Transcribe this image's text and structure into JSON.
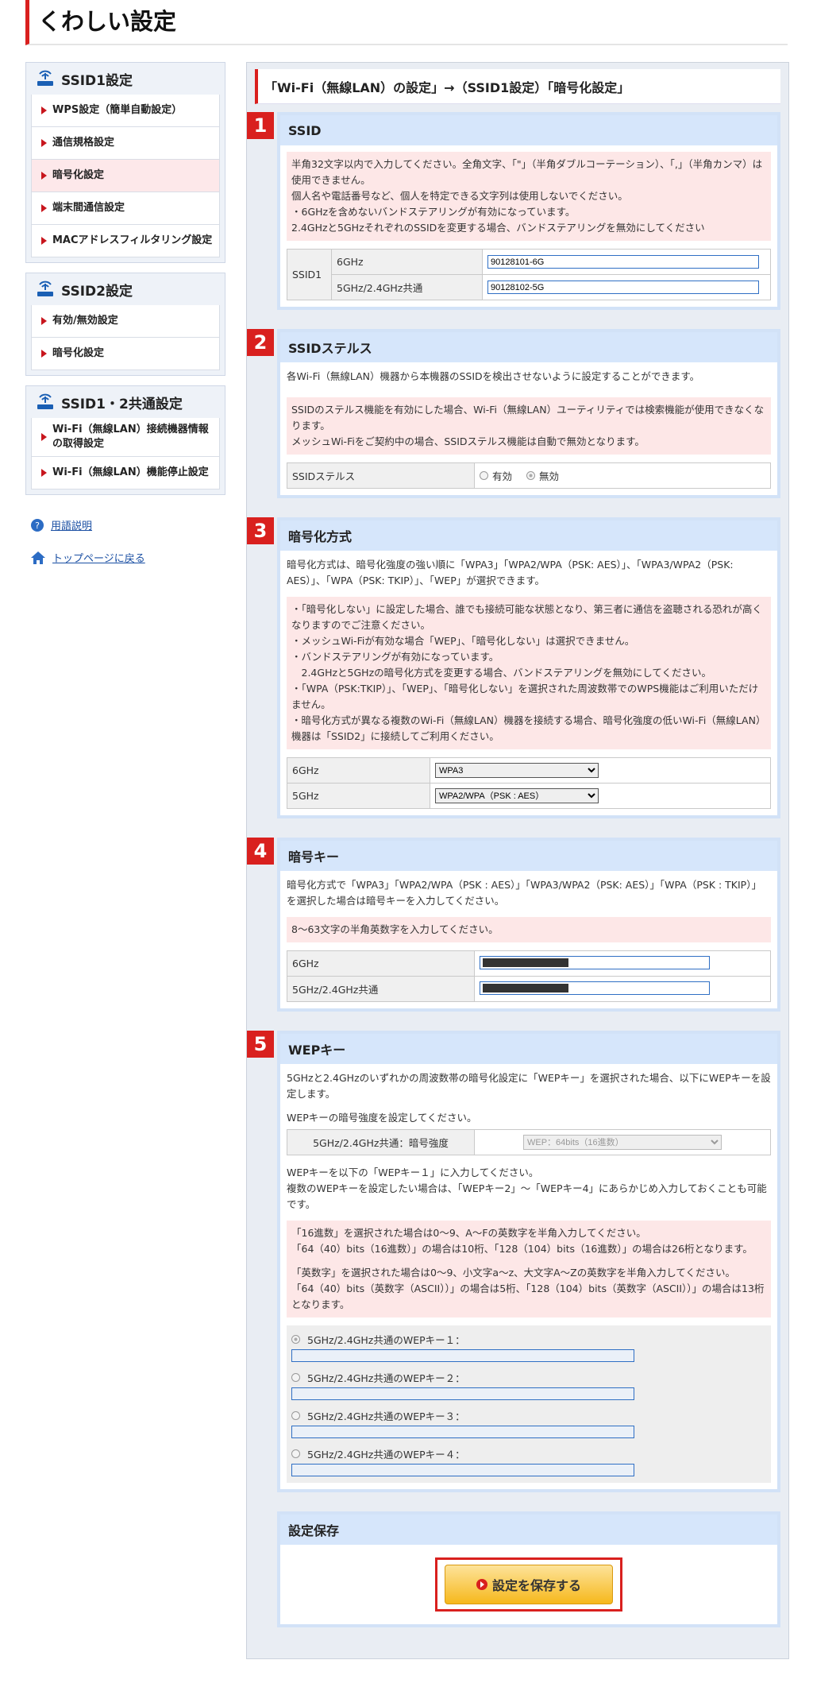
{
  "page_title": "くわしい設定",
  "sidebar": {
    "groups": [
      {
        "title": "SSID1設定",
        "items": [
          "WPS設定（簡単自動設定）",
          "通信規格設定",
          "暗号化設定",
          "端末間通信設定",
          "MACアドレスフィルタリング設定"
        ],
        "active": 2
      },
      {
        "title": "SSID2設定",
        "items": [
          "有効/無効設定",
          "暗号化設定"
        ]
      },
      {
        "title": "SSID1・2共通設定",
        "items": [
          "Wi-Fi（無線LAN）接続機器情報の取得設定",
          "Wi-Fi（無線LAN）機能停止設定"
        ]
      }
    ],
    "links": {
      "glossary": "用語説明",
      "home": "トップページに戻る"
    }
  },
  "main": {
    "title": "「Wi-Fi（無線LAN）の設定」→（SSID1設定）「暗号化設定」",
    "ssid": {
      "num": "1",
      "head": "SSID",
      "warn": [
        "半角32文字以内で入力してください。全角文字、「\"」（半角ダブルコーテーション）、「,」（半角カンマ）は使用できません。",
        "個人名や電話番号など、個人を特定できる文字列は使用しないでください。",
        "・6GHzを含めないバンドステアリングが有効になっています。",
        "2.4GHzと5GHzそれぞれのSSIDを変更する場合、バンドステアリングを無効にしてください"
      ],
      "row_label": "SSID1",
      "band1": "6GHz",
      "band2": "5GHz/2.4GHz共通",
      "val1": "90128101-6G",
      "val2": "90128102-5G"
    },
    "stealth": {
      "num": "2",
      "head": "SSIDステルス",
      "desc": "各Wi-Fi（無線LAN）機器から本機器のSSIDを検出させないように設定することができます。",
      "warn": [
        "SSIDのステルス機能を有効にした場合、Wi-Fi（無線LAN）ユーティリティでは検索機能が使用できなくなります。",
        "メッシュWi-Fiをご契約中の場合、SSIDステルス機能は自動で無効となります。"
      ],
      "label": "SSIDステルス",
      "opt_on": "有効",
      "opt_off": "無効"
    },
    "enc": {
      "num": "3",
      "head": "暗号化方式",
      "desc": "暗号化方式は、暗号化強度の強い順に「WPA3」「WPA2/WPA（PSK: AES）」、「WPA3/WPA2（PSK: AES）」、「WPA（PSK: TKIP）」、「WEP」が選択できます。",
      "warn": [
        "・「暗号化しない」に設定した場合、誰でも接続可能な状態となり、第三者に通信を盗聴される恐れが高くなりますのでご注意ください。",
        "・メッシュWi-Fiが有効な場合「WEP」、「暗号化しない」は選択できません。",
        "・バンドステアリングが有効になっています。",
        "　2.4GHzと5GHzの暗号化方式を変更する場合、バンドステアリングを無効にしてください。",
        "・「WPA（PSK:TKIP）」、「WEP」、「暗号化しない」を選択された周波数帯でのWPS機能はご利用いただけません。",
        "・暗号化方式が異なる複数のWi-Fi（無線LAN）機器を接続する場合、暗号化強度の低いWi-Fi（無線LAN）機器は「SSID2」に接続してご利用ください。"
      ],
      "band1": "6GHz",
      "band2": "5GHz",
      "sel1": "WPA3",
      "sel2": "WPA2/WPA（PSK : AES）"
    },
    "key": {
      "num": "4",
      "head": "暗号キー",
      "desc": "暗号化方式で「WPA3」「WPA2/WPA（PSK : AES）」「WPA3/WPA2（PSK: AES）」「WPA（PSK : TKIP）」を選択した場合は暗号キーを入力してください。",
      "warn": "8～63文字の半角英数字を入力してください。",
      "band1": "6GHz",
      "band2": "5GHz/2.4GHz共通"
    },
    "wep": {
      "num": "5",
      "head": "WEPキー",
      "desc1": "5GHzと2.4GHzのいずれかの周波数帯の暗号化設定に「WEPキー」を選択された場合、以下にWEPキーを設定します。",
      "desc2": "WEPキーの暗号強度を設定してください。",
      "strength_label": "5GHz/2.4GHz共通：暗号強度",
      "strength_val": "WEP：64bits（16進数）",
      "desc3": "WEPキーを以下の「WEPキー１」に入力してください。",
      "desc4": "複数のWEPキーを設定したい場合は、「WEPキー2」～「WEPキー4」にあらかじめ入力しておくことも可能です。",
      "warn": [
        "「16進数」を選択された場合は0～9、A～Fの英数字を半角入力してください。",
        "「64（40）bits（16進数）」の場合は10桁、「128（104）bits（16進数）」の場合は26桁となります。",
        "",
        "「英数字」を選択された場合は0～9、小文字a～z、大文字A～Zの英数字を半角入力してください。",
        "「64（40）bits（英数字（ASCII））」の場合は5桁、「128（104）bits（英数字（ASCII））」の場合は13桁となります。"
      ],
      "keys": [
        "5GHz/2.4GHz共通のWEPキー１：",
        "5GHz/2.4GHz共通のWEPキー２：",
        "5GHz/2.4GHz共通のWEPキー３：",
        "5GHz/2.4GHz共通のWEPキー４："
      ]
    },
    "save": {
      "head": "設定保存",
      "button": "設定を保存する"
    }
  }
}
